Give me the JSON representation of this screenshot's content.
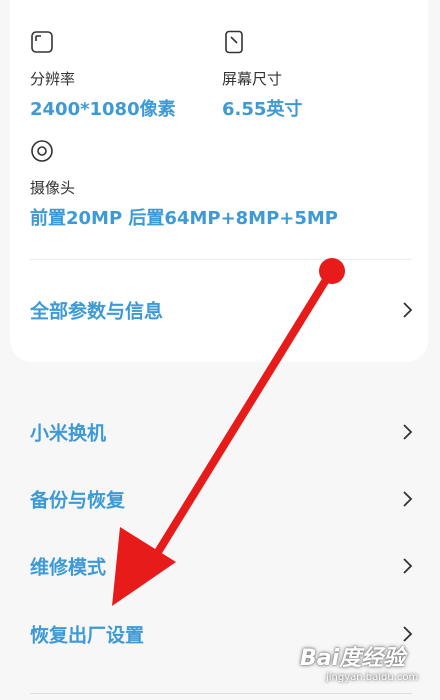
{
  "specs": {
    "resolution": {
      "label": "分辨率",
      "value": "2400*1080像素",
      "icon": "resolution-icon"
    },
    "screen_size": {
      "label": "屏幕尺寸",
      "value": "6.55英寸",
      "icon": "screen-size-icon"
    },
    "camera": {
      "label": "摄像头",
      "value": "前置20MP 后置64MP+8MP+5MP",
      "icon": "camera-icon"
    }
  },
  "all_params": {
    "label": "全部参数与信息"
  },
  "menu": {
    "items": [
      {
        "label": "小米换机"
      },
      {
        "label": "备份与恢复"
      },
      {
        "label": "维修模式"
      },
      {
        "label": "恢复出厂设置"
      }
    ]
  },
  "colors": {
    "accent": "#3d9ad6",
    "annotation_arrow": "#e81b1b"
  },
  "watermark": {
    "main": "Bai度经验",
    "sub": "jingyan.baidu.com"
  }
}
